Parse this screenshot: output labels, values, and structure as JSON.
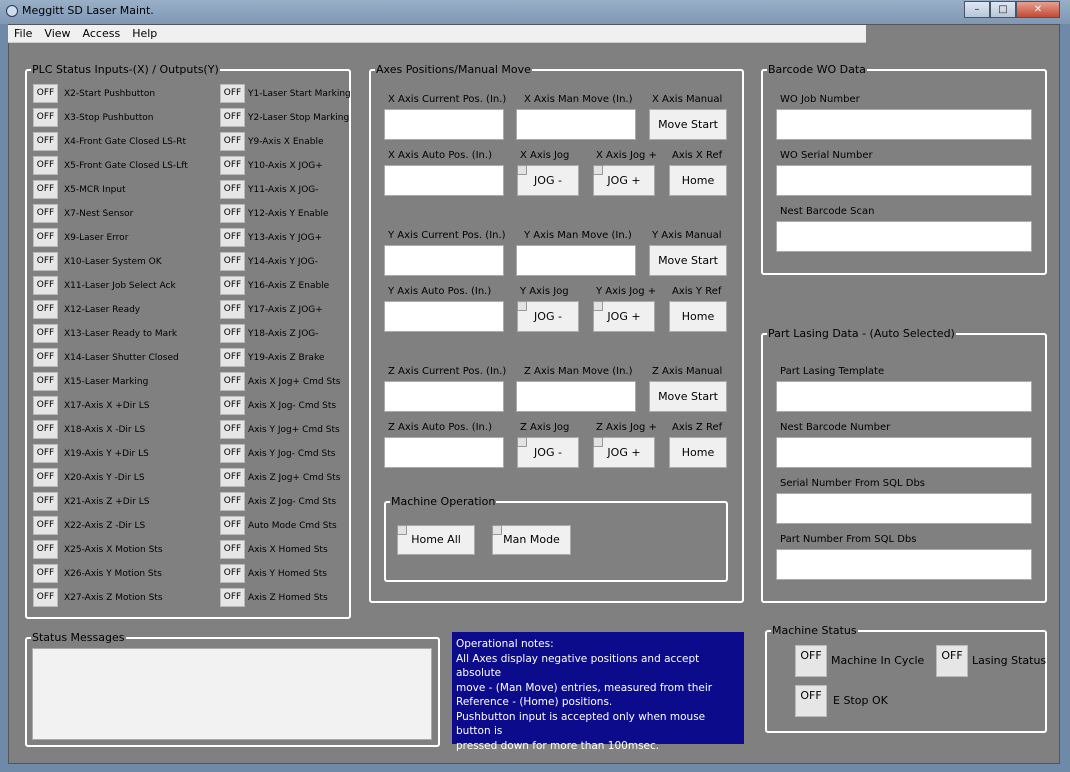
{
  "window": {
    "title": "Meggitt SD Laser Maint."
  },
  "menu": [
    "File",
    "View",
    "Access",
    "Help"
  ],
  "plc": {
    "title": "PLC Status Inputs-(X) / Outputs(Y)",
    "off_label": "OFF",
    "inputs": [
      "X2-Start Pushbutton",
      "X3-Stop Pushbutton",
      "X4-Front Gate Closed LS-Rt",
      "X5-Front Gate Closed LS-Lft",
      "X5-MCR Input",
      "X7-Nest Sensor",
      "X9-Laser Error",
      "X10-Laser System OK",
      "X11-Laser Job Select Ack",
      "X12-Laser Ready",
      "X13-Laser Ready to Mark",
      "X14-Laser Shutter Closed",
      "X15-Laser Marking",
      "X17-Axis X +Dir LS",
      "X18-Axis X -Dir LS",
      "X19-Axis Y +Dir LS",
      "X20-Axis Y -Dir LS",
      "X21-Axis Z +Dir LS",
      "X22-Axis Z -Dir LS",
      "X25-Axis X Motion Sts",
      "X26-Axis Y Motion Sts",
      "X27-Axis Z Motion Sts"
    ],
    "outputs": [
      "Y1-Laser Start Marking",
      "Y2-Laser Stop Marking",
      "Y9-Axis X Enable",
      "Y10-Axis X JOG+",
      "Y11-Axis X JOG-",
      "Y12-Axis Y Enable",
      "Y13-Axis Y JOG+",
      "Y14-Axis Y JOG-",
      "Y16-Axis Z Enable",
      "Y17-Axis Z JOG+",
      "Y18-Axis Z JOG-",
      "Y19-Axis Z Brake",
      "Axis X Jog+ Cmd Sts",
      "Axis X Jog- Cmd Sts",
      "Axis Y Jog+ Cmd Sts",
      "Axis Y Jog- Cmd Sts",
      "Axis Z Jog+ Cmd Sts",
      "Axis Z Jog- Cmd Sts",
      "Auto Mode Cmd Sts",
      "Axis X Homed Sts",
      "Axis Y Homed Sts",
      "Axis Z Homed Sts"
    ]
  },
  "axes": {
    "title": "Axes Positions/Manual Move",
    "x": {
      "current": "X Axis Current Pos. (In.)",
      "man_move": "X Axis Man Move (In.)",
      "manual": "X Axis Manual",
      "move_start": "Move Start",
      "auto_pos": "X Axis Auto Pos. (In.)",
      "jog_minus_label": "X Axis Jog",
      "jog_plus_label": "X Axis Jog +",
      "ref_label": "Axis X Ref",
      "jog_minus": "JOG -",
      "jog_plus": "JOG +",
      "home": "Home"
    },
    "y": {
      "current": "Y Axis Current Pos. (In.)",
      "man_move": "Y Axis Man Move (In.)",
      "manual": "Y Axis Manual",
      "move_start": "Move Start",
      "auto_pos": "Y Axis Auto Pos. (In.)",
      "jog_minus_label": "Y Axis Jog",
      "jog_plus_label": "Y Axis Jog +",
      "ref_label": "Axis Y Ref",
      "jog_minus": "JOG -",
      "jog_plus": "JOG +",
      "home": "Home"
    },
    "z": {
      "current": "Z Axis Current Pos. (In.)",
      "man_move": "Z Axis Man Move (In.)",
      "manual": "Z Axis Manual",
      "move_start": "Move Start",
      "auto_pos": "Z Axis Auto Pos. (In.)",
      "jog_minus_label": "Z Axis Jog",
      "jog_plus_label": "Z Axis Jog +",
      "ref_label": "Axis Z Ref",
      "jog_minus": "JOG -",
      "jog_plus": "JOG +",
      "home": "Home"
    },
    "machine_op": {
      "title": "Machine Operation",
      "home_all": "Home All",
      "man_mode": "Man Mode"
    }
  },
  "barcode": {
    "title": "Barcode WO Data",
    "job_number": "WO Job Number",
    "serial_number": "WO Serial Number",
    "nest_scan": "Nest Barcode Scan"
  },
  "part": {
    "title": "Part Lasing Data - (Auto Selected)",
    "template": "Part Lasing Template",
    "nest_barcode": "Nest Barcode Number",
    "serial_sql": "Serial Number From SQL Dbs",
    "part_sql": "Part Number From SQL Dbs"
  },
  "status": {
    "title": "Status Messages"
  },
  "notes": {
    "lines": [
      "Operational notes:",
      "All Axes display negative positions and accept absolute",
      "move - (Man Move) entries, measured from their",
      "Reference - (Home) positions.",
      "Pushbutton input is accepted only when mouse button is",
      "pressed down for more than 100msec."
    ]
  },
  "machine_status": {
    "title": "Machine Status",
    "off": "OFF",
    "in_cycle": "Machine In Cycle",
    "lasing": "Lasing Status",
    "estop": "E Stop OK"
  },
  "colors": {
    "panel": "#808080",
    "notes_bg": "#0b0b8c",
    "border": "#ffffff"
  }
}
